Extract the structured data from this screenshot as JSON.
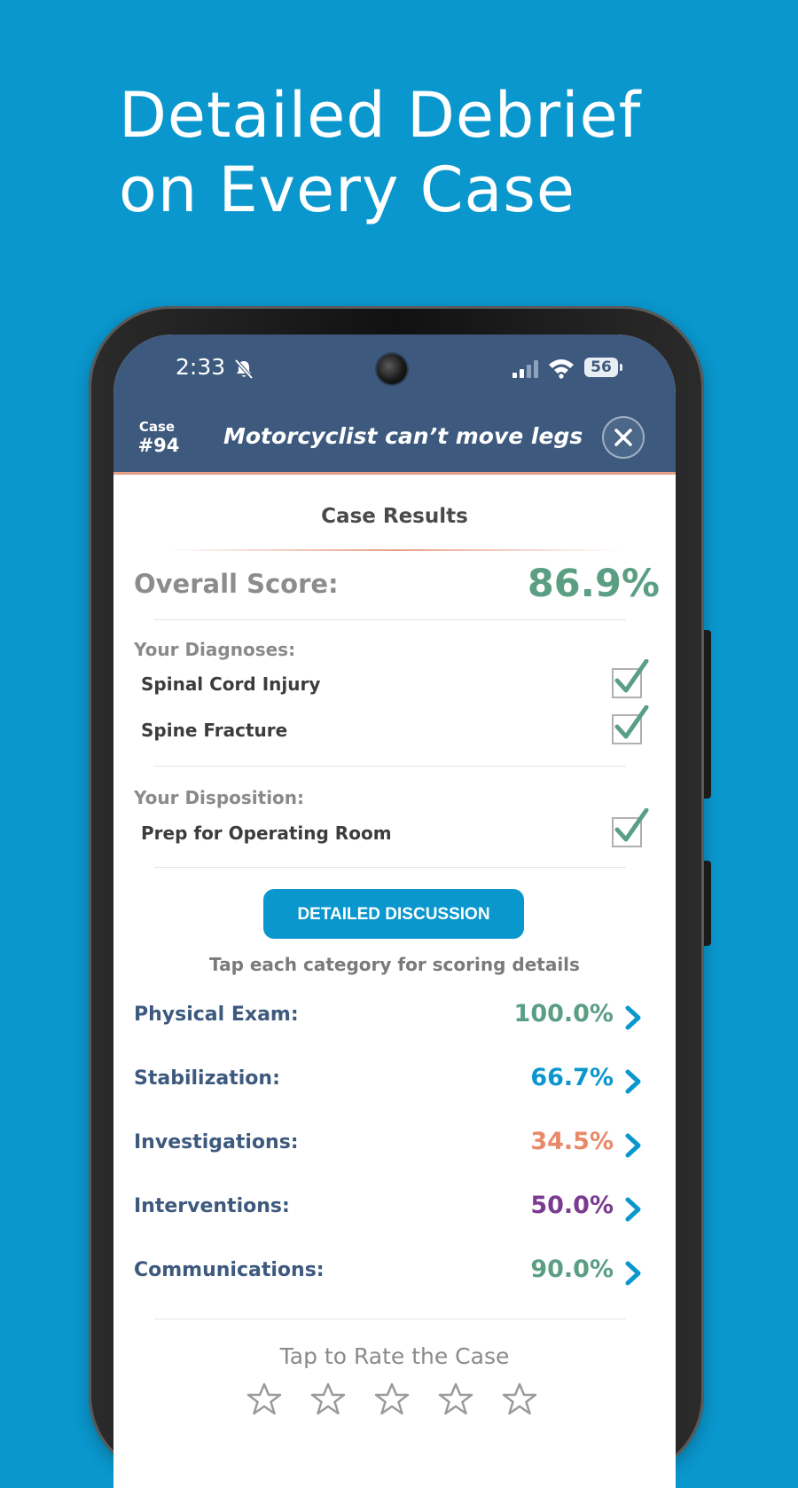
{
  "headline": {
    "line1": "Detailed Debrief",
    "line2": "on Every Case"
  },
  "status_bar": {
    "time": "2:33",
    "battery": "56"
  },
  "header": {
    "case_label": "Case",
    "case_number": "#94",
    "title": "Motorcyclist can’t move legs"
  },
  "results": {
    "section_title": "Case Results",
    "overall_label": "Overall Score:",
    "overall_value": "86.9%",
    "diagnoses_label": "Your Diagnoses:",
    "diagnoses": [
      "Spinal Cord Injury",
      "Spine Fracture"
    ],
    "disposition_label": "Your Disposition:",
    "disposition": "Prep for Operating Room",
    "discussion_button": "DETAILED DISCUSSION",
    "hint": "Tap each category for scoring details",
    "categories": [
      {
        "label": "Physical Exam:",
        "value": "100.0%",
        "color": "#5a9e84"
      },
      {
        "label": "Stabilization:",
        "value": "66.7%",
        "color": "#0a97cd"
      },
      {
        "label": "Investigations:",
        "value": "34.5%",
        "color": "#e88a6a"
      },
      {
        "label": "Interventions:",
        "value": "50.0%",
        "color": "#7b3b92"
      },
      {
        "label": "Communications:",
        "value": "90.0%",
        "color": "#5a9e84"
      }
    ],
    "rate_text": "Tap to Rate the Case"
  },
  "colors": {
    "background": "#0a97cd",
    "header": "#3d5a7e",
    "accent_green": "#5a9e84",
    "chevron": "#0a97cd"
  },
  "icons": [
    "bell-off-icon",
    "signal-icon",
    "wifi-icon",
    "close-icon",
    "check-icon",
    "chevron-right-icon",
    "star-icon"
  ]
}
